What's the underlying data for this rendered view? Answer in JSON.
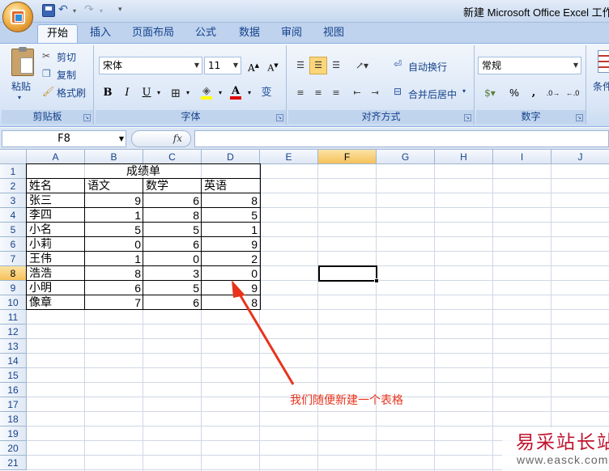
{
  "window": {
    "title": "新建 Microsoft Office Excel 工作表"
  },
  "quick_access": {
    "save_icon": "save-icon",
    "undo_icon": "undo-icon",
    "redo_icon": "redo-icon"
  },
  "tabs": [
    {
      "label": "开始",
      "active": true
    },
    {
      "label": "插入"
    },
    {
      "label": "页面布局"
    },
    {
      "label": "公式"
    },
    {
      "label": "数据"
    },
    {
      "label": "审阅"
    },
    {
      "label": "视图"
    }
  ],
  "ribbon": {
    "clipboard": {
      "label": "剪贴板",
      "paste": "粘贴",
      "cut": "剪切",
      "copy": "复制",
      "format_painter": "格式刷"
    },
    "font": {
      "label": "字体",
      "font_name": "宋体",
      "font_size": "11",
      "bold": "B",
      "italic": "I",
      "underline": "U",
      "phonetic": "变"
    },
    "alignment": {
      "label": "对齐方式",
      "wrap_text": "自动换行",
      "merge_center": "合并后居中"
    },
    "number": {
      "label": "数字",
      "format": "常规",
      "percent": "%",
      "comma": ","
    },
    "styles": {
      "label": "条件"
    }
  },
  "formula_bar": {
    "name_box": "F8",
    "fx": "fx",
    "value": ""
  },
  "columns": [
    "A",
    "B",
    "C",
    "D",
    "E",
    "F",
    "G",
    "H",
    "I",
    "J"
  ],
  "rows": [
    "1",
    "2",
    "3",
    "4",
    "5",
    "6",
    "7",
    "8",
    "9",
    "10",
    "11",
    "12",
    "13",
    "14",
    "15",
    "16",
    "17",
    "18",
    "19",
    "20",
    "21"
  ],
  "selected_cell": {
    "column": "F",
    "row": "8"
  },
  "sheet": {
    "title": "成绩单",
    "headers": [
      "姓名",
      "语文",
      "数学",
      "英语"
    ],
    "records": [
      [
        "张三",
        "9",
        "6",
        "8"
      ],
      [
        "李四",
        "1",
        "8",
        "5"
      ],
      [
        "小名",
        "5",
        "5",
        "1"
      ],
      [
        "小莉",
        "0",
        "6",
        "9"
      ],
      [
        "王伟",
        "1",
        "0",
        "2"
      ],
      [
        "浩浩",
        "8",
        "3",
        "0"
      ],
      [
        "小明",
        "6",
        "5",
        "9"
      ],
      [
        "像章",
        "7",
        "6",
        "8"
      ]
    ]
  },
  "annotation": {
    "text": "我们随便新建一个表格",
    "color": "#e8331c"
  },
  "watermark": {
    "name": "易采站长站",
    "url": "www.easck.com"
  }
}
